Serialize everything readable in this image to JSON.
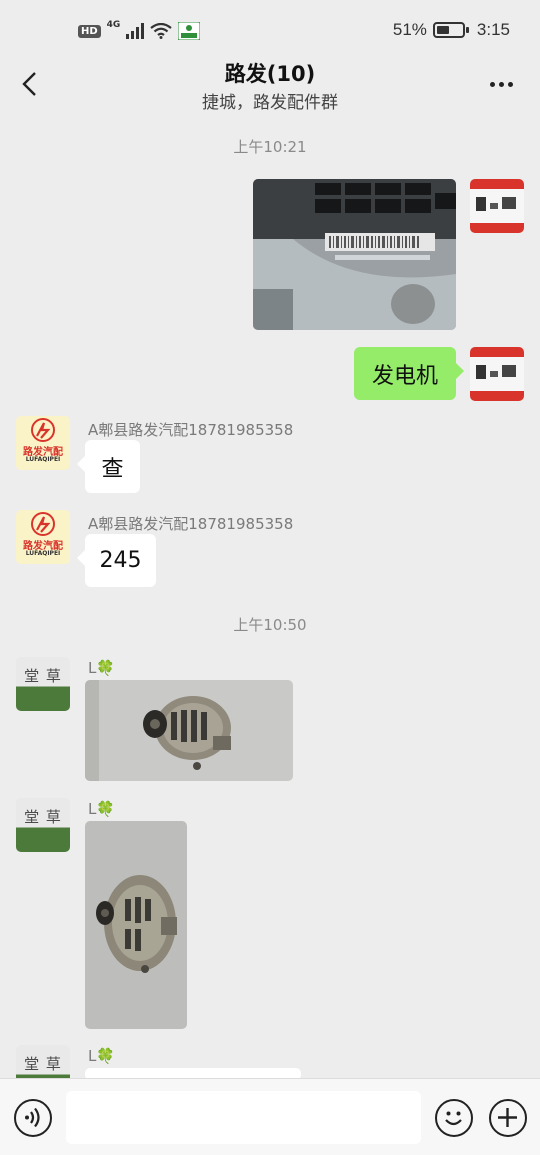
{
  "status_bar": {
    "hd": "HD",
    "network": "4G",
    "battery_percent": "51%",
    "battery_level": 0.51,
    "time": "3:15"
  },
  "header": {
    "title": "路发(10)",
    "subtitle": "捷城，路发配件群",
    "back_icon": "chevron-left-icon",
    "more_icon": "more-dots-icon"
  },
  "messages": {
    "time_1": "上午10:21",
    "out_text": "发电机",
    "brand_sender": "A郫县路发汽配18781985358",
    "brand_logo_text": "路发汽配",
    "brand_logo_sub": "LUFAQIPEI",
    "brand_msg_1": "查",
    "brand_msg_2": "245",
    "time_2": "上午10:50",
    "plant_sender": "L🍀",
    "plant_avatar_text": "堂 草"
  },
  "input_bar": {
    "voice_icon": "voice-icon",
    "emoji_icon": "emoji-icon",
    "plus_icon": "plus-icon"
  },
  "colors": {
    "background": "#ededed",
    "outgoing_bubble": "#95ec69",
    "incoming_bubble": "#ffffff",
    "brand_red": "#d9342b"
  }
}
